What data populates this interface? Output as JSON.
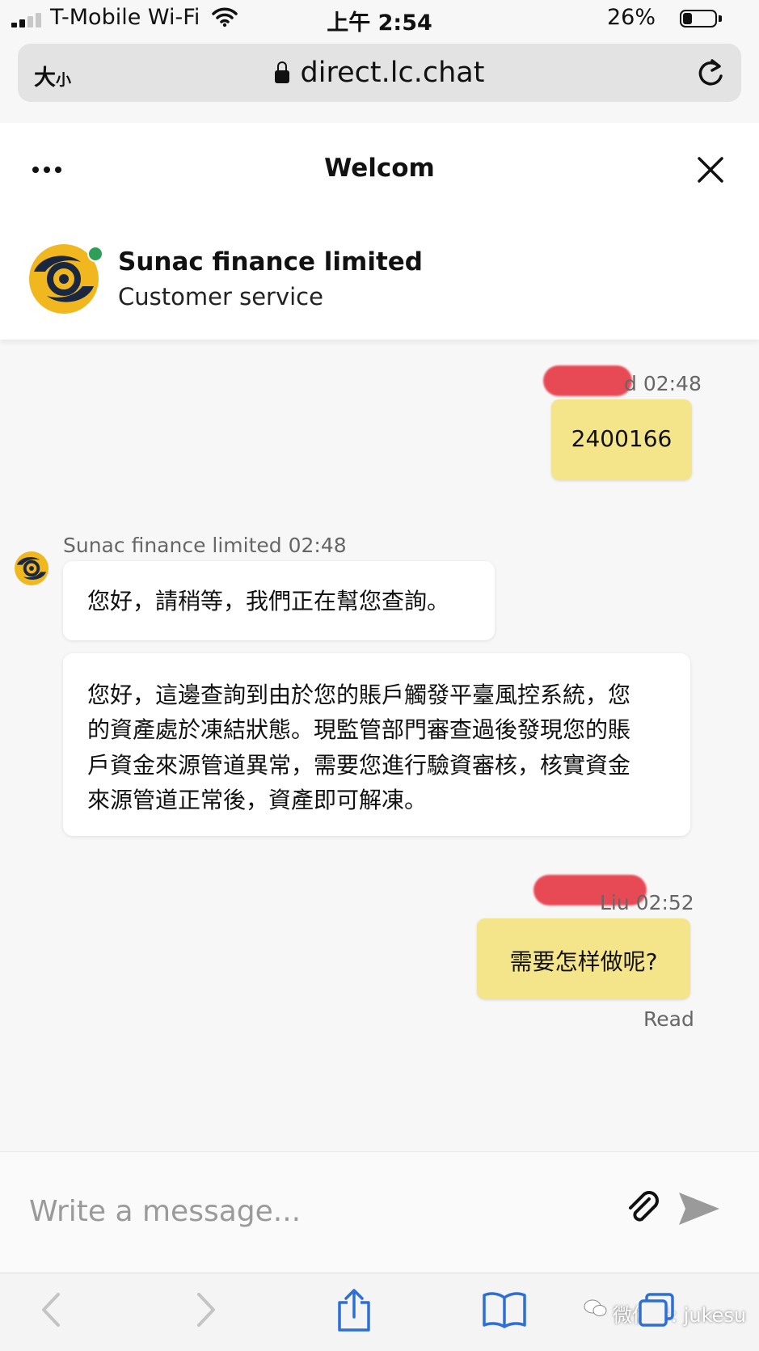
{
  "status_bar": {
    "carrier": "T-Mobile Wi-Fi",
    "time": "上午 2:54",
    "battery": "26%"
  },
  "browser": {
    "text_size_label": "大",
    "text_size_small": "小",
    "url": "direct.lc.chat"
  },
  "chat": {
    "title": "Welcom",
    "agent": {
      "name": "Sunac finance limited",
      "role": "Customer service"
    },
    "messages": [
      {
        "from": "user",
        "meta": "d 02:48",
        "text": "2400166"
      },
      {
        "from": "agent",
        "meta": "Sunac finance limited 02:48",
        "text": "您好，請稍等，我們正在幫您查詢。"
      },
      {
        "from": "agent",
        "lines": [
          "您好，這邊查詢到由於您的賬戶觸發平臺風控系統，您",
          "的資產處於凍結狀態。現監管部門審查過後發現您的賬",
          "戶資金來源管道異常，需要您進行驗資審核，核實資金",
          "來源管道正常後，資產即可解凍。"
        ]
      },
      {
        "from": "user",
        "meta": "Liu 02:52",
        "text": "需要怎样做呢?",
        "receipt": "Read"
      }
    ]
  },
  "composer": {
    "placeholder": "Write a message..."
  },
  "overlay": {
    "wechat_label": "微信号: jukesu"
  },
  "colors": {
    "user_bubble": "#f4e48a",
    "agent_bubble": "#ffffff",
    "online": "#2f9e57",
    "logo_gold": "#f0b81e",
    "logo_navy": "#1a2740"
  }
}
